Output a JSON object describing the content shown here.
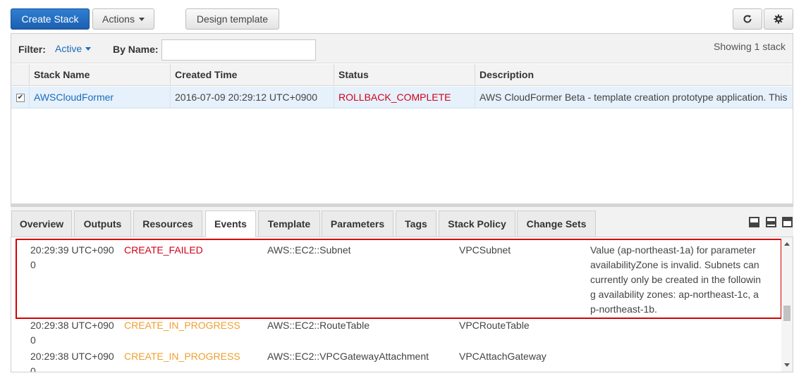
{
  "toolbar": {
    "create_stack": "Create Stack",
    "actions": "Actions",
    "design_template": "Design template"
  },
  "filter": {
    "filter_label": "Filter:",
    "filter_value": "Active",
    "by_name_label": "By Name:",
    "by_name_value": "",
    "showing": "Showing 1 stack"
  },
  "stacks_table": {
    "columns": [
      "Stack Name",
      "Created Time",
      "Status",
      "Description"
    ],
    "rows": [
      {
        "selected": true,
        "stack_name": "AWSCloudFormer",
        "created_time": "2016-07-09 20:29:12 UTC+0900",
        "status": "ROLLBACK_COMPLETE",
        "description": "AWS CloudFormer Beta - template creation prototype application. This"
      }
    ]
  },
  "tabs": [
    "Overview",
    "Outputs",
    "Resources",
    "Events",
    "Template",
    "Parameters",
    "Tags",
    "Stack Policy",
    "Change Sets"
  ],
  "active_tab": "Events",
  "events": [
    {
      "time_line1": "20:29:39 UTC+090",
      "time_line2": "0",
      "status": "CREATE_FAILED",
      "type": "AWS::EC2::Subnet",
      "logical_id": "VPCSubnet",
      "reason_lines": [
        "Value (ap-northeast-1a) for parameter",
        "availabilityZone is invalid. Subnets can",
        "currently only be created in the followin",
        "g availability zones: ap-northeast-1c, a",
        "p-northeast-1b."
      ]
    },
    {
      "time_line1": "20:29:38 UTC+090",
      "time_line2": "0",
      "status": "CREATE_IN_PROGRESS",
      "type": "AWS::EC2::RouteTable",
      "logical_id": "VPCRouteTable",
      "reason_lines": []
    },
    {
      "time_line1": "20:29:38 UTC+090",
      "time_line2": "0",
      "status": "CREATE_IN_PROGRESS",
      "type": "AWS::EC2::VPCGatewayAttachment",
      "logical_id": "VPCAttachGateway",
      "reason_lines": []
    }
  ],
  "colors": {
    "primary": "#1c5fb0",
    "link": "#1b6cbb",
    "failed": "#d0021b",
    "in_progress": "#f0a030",
    "highlight": "#d80000"
  },
  "icons": {
    "refresh": "refresh-icon",
    "settings": "gear-icon"
  }
}
